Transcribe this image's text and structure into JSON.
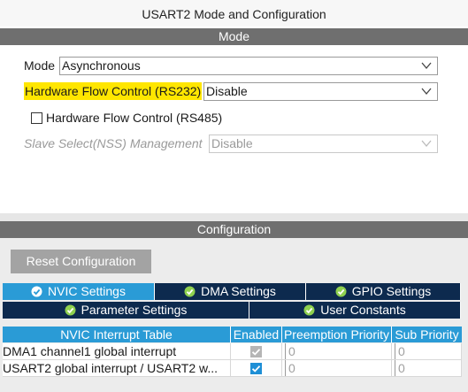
{
  "window": {
    "title": "USART2 Mode and Configuration"
  },
  "mode_section": {
    "header": "Mode",
    "mode": {
      "label": "Mode",
      "value": "Asynchronous"
    },
    "hw_flow_rs232": {
      "label": "Hardware Flow Control (RS232)",
      "value": "Disable"
    },
    "hw_flow_rs485": {
      "label": "Hardware Flow Control (RS485)",
      "checked": false
    },
    "slave_select": {
      "label": "Slave Select(NSS) Management",
      "value": "Disable",
      "disabled": true
    }
  },
  "config_section": {
    "header": "Configuration",
    "reset_label": "Reset Configuration",
    "tabs": [
      {
        "label": "NVIC Settings",
        "active": true
      },
      {
        "label": "DMA Settings",
        "active": false
      },
      {
        "label": "GPIO Settings",
        "active": false
      },
      {
        "label": "Parameter Settings",
        "active": false
      },
      {
        "label": "User Constants",
        "active": false
      }
    ],
    "table": {
      "columns": [
        "NVIC Interrupt Table",
        "Enabled",
        "Preemption Priority",
        "Sub Priority"
      ],
      "rows": [
        {
          "name": "DMA1 channel1 global interrupt",
          "enabled": true,
          "enabled_editable": false,
          "preemption": "0",
          "sub": "0"
        },
        {
          "name": "USART2 global interrupt / USART2 w...",
          "enabled": true,
          "enabled_editable": true,
          "preemption": "0",
          "sub": "0"
        }
      ]
    }
  },
  "colors": {
    "section_header": "#6f6f6f",
    "tab_active": "#2a9bd6",
    "tab_inactive": "#0d2a4e",
    "highlight": "#ffe600",
    "checkbox_blue": "#1e8fd6"
  }
}
